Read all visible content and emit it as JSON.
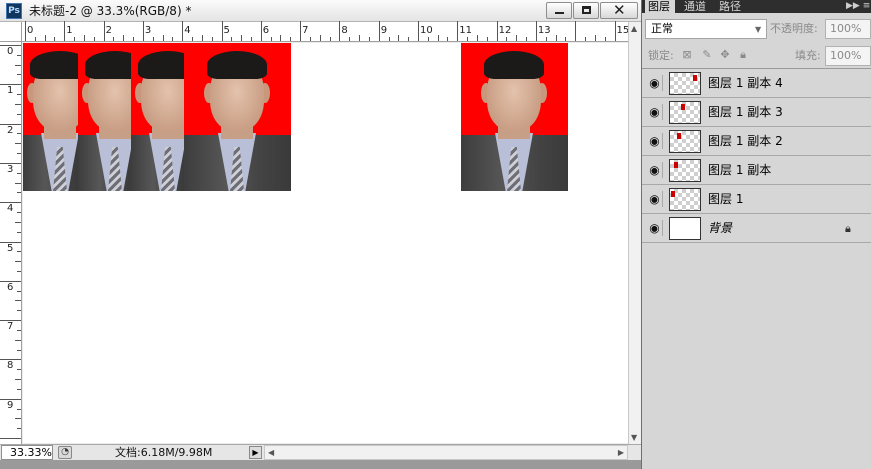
{
  "document": {
    "title": "未标题-2 @ 33.3%(RGB/8) *",
    "app_icon": "Ps",
    "zoom": "33.33%",
    "doc_size": "文档:6.18M/9.98M",
    "ruler_top_labels": [
      "0",
      "1",
      "2",
      "3",
      "4",
      "5",
      "6",
      "7",
      "8",
      "9",
      "10",
      "11",
      "12",
      "13",
      "15"
    ],
    "ruler_left_labels": [
      "0",
      "1",
      "2",
      "3",
      "4",
      "5",
      "6",
      "7",
      "8",
      "9"
    ],
    "background_color": "#ffffff",
    "photo_background_color": "#ff0000"
  },
  "window_controls": {
    "minimize": "minimize-icon",
    "maximize": "maximize-icon",
    "close": "close-icon"
  },
  "panel": {
    "tabs": [
      "图层",
      "通道",
      "路径"
    ],
    "active_tab": "图层",
    "blend_mode": "正常",
    "opacity_label": "不透明度:",
    "opacity_value": "100%",
    "lock_label": "锁定:",
    "fill_label": "填充:",
    "fill_value": "100%",
    "layers": [
      {
        "name": "图层 1 副本 4",
        "visible": true
      },
      {
        "name": "图层 1 副本 3",
        "visible": true
      },
      {
        "name": "图层 1 副本 2",
        "visible": true
      },
      {
        "name": "图层 1 副本",
        "visible": true
      },
      {
        "name": "图层 1",
        "visible": true
      },
      {
        "name": "背景",
        "visible": true,
        "locked": true
      }
    ]
  }
}
